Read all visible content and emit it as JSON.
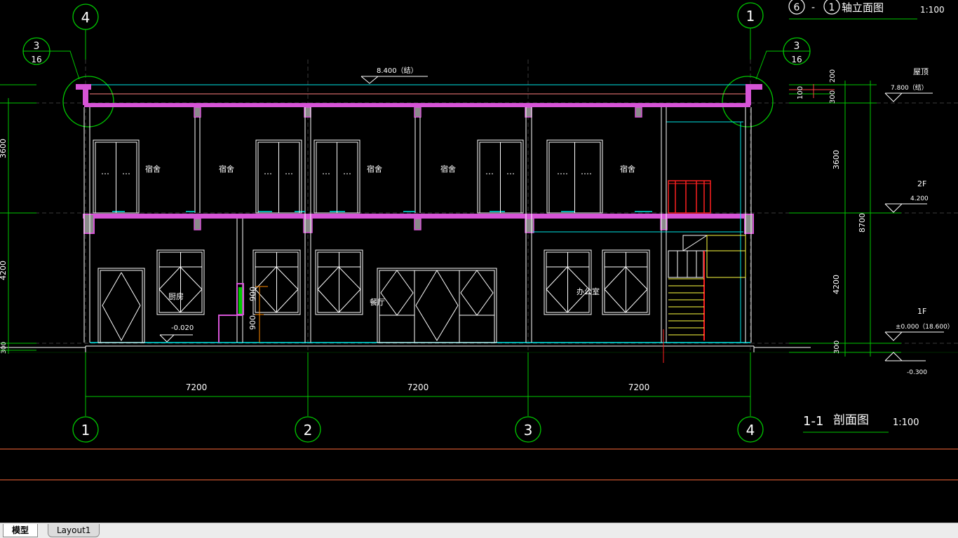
{
  "colors": {
    "background": "#000000",
    "axis_line": "#00c800",
    "grid": "#3a3a3a",
    "wall": "#ffffff",
    "slab": "#d654d6",
    "slab_core": "#8a8a8a",
    "cyan": "#00e5e5",
    "red": "#ff2020",
    "yellow": "#ffff40",
    "orange": "#ff8a00",
    "text": "#ffffff"
  },
  "top": {
    "elev_title": {
      "axis_a": "6",
      "dash": "-",
      "axis_b": "1",
      "name": "轴立面图",
      "scale": "1:100"
    },
    "axis_left": "4",
    "axis_right": "1",
    "detail_left": {
      "num": "3",
      "sheet": "16"
    },
    "detail_right": {
      "num": "3",
      "sheet": "16"
    },
    "roof_parapet_elev": "8.400（结）"
  },
  "rooms": {
    "upper": [
      "宿舍",
      "宿舍",
      "宿舍",
      "宿舍",
      "宿舍"
    ],
    "kitchen": "厨房",
    "dining": "餐厅",
    "office": "办公室"
  },
  "levels": {
    "roof": {
      "label": "屋顶",
      "elev": "7.800（结）"
    },
    "second": {
      "label": "2F",
      "elev": "4.200"
    },
    "first": {
      "label": "1F",
      "elev": "±0.000（18.600）"
    },
    "base": {
      "elev": "-0.300"
    },
    "kitchen_floor": "-0.020"
  },
  "dims": {
    "left_stub_upper": "3600",
    "left_stub_lower": "4200",
    "left_stub_base": "300",
    "right_200": "200",
    "right_100": "100",
    "right_300_top": "300",
    "right_3600": "3600",
    "right_8700": "8700",
    "right_4200": "4200",
    "right_300_bottom": "300",
    "window_900_top": "900",
    "window_900_bottom": "900",
    "bays": [
      "7200",
      "7200",
      "7200"
    ]
  },
  "bottom_axes": [
    "1",
    "2",
    "3",
    "4"
  ],
  "section": {
    "title": "1-1",
    "name": "剖面图",
    "scale": "1:100"
  },
  "tabs": {
    "model": "模型",
    "layout1": "Layout1"
  }
}
